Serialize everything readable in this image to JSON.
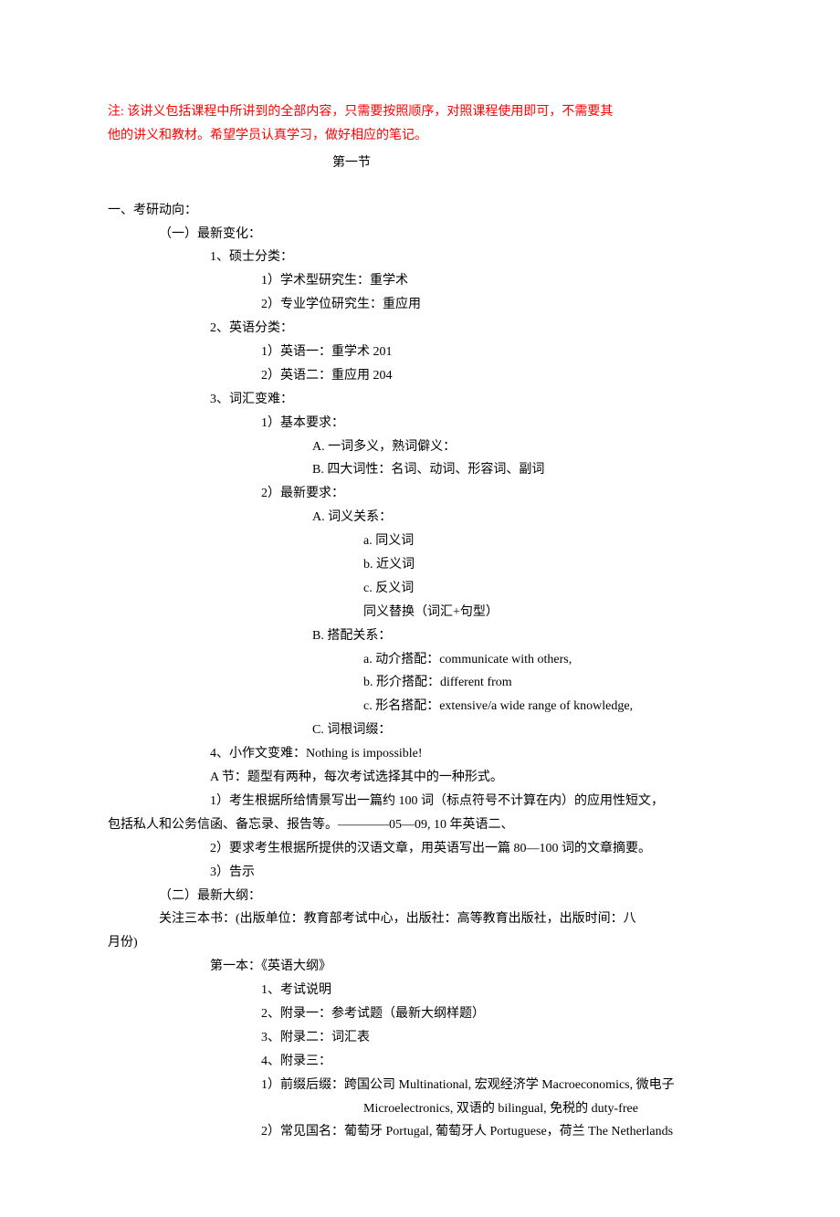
{
  "note": {
    "l1": "注: 该讲义包括课程中所讲到的全部内容，只需要按照顺序，对照课程使用即可，不需要其",
    "l2": "他的讲义和教材。希望学员认真学习，做好相应的笔记。"
  },
  "title": "第一节",
  "s1": {
    "t": "一、考研动向：",
    "a": "（一）最新变化：",
    "a1": "1、硕士分类：",
    "a1_1": "1）学术型研究生：重学术",
    "a1_2": "2）专业学位研究生：重应用",
    "a2": "2、英语分类：",
    "a2_1": "1）英语一：重学术 201",
    "a2_2": "2）英语二：重应用 204",
    "a3": "3、词汇变难：",
    "a3_1": "1）基本要求：",
    "a3_1a": "A.  一词多义，熟词僻义：",
    "a3_1b": "B.  四大词性：名词、动词、形容词、副词",
    "a3_2": "2）最新要求：",
    "a3_2a": "A.  词义关系：",
    "a3_2a_a": "a.    同义词",
    "a3_2a_b": "b.    近义词",
    "a3_2a_c": "c.    反义词",
    "a3_2a_d": "同义替换（词汇+句型）",
    "a3_2b": "B.  搭配关系：",
    "a3_2b_a": "a.  动介搭配：communicate with others,",
    "a3_2b_b": "b.  形介搭配：different from",
    "a3_2b_c": "c.  形名搭配：extensive/a wide range of knowledge,",
    "a3_2c": "C. 词根词缀：",
    "a4": "4、小作文变难：Nothing is impossible!",
    "a4_A": "A 节：题型有两种，每次考试选择其中的一种形式。",
    "a4_1_a": "1）考生根据所给情景写出一篇约 100 词（标点符号不计算在内）的应用性短文，",
    "a4_1_b": "包括私人和公务信函、备忘录、报告等。————05—09, 10 年英语二、",
    "a4_2": "2）要求考生根据所提供的汉语文章，用英语写出一篇 80—100 词的文章摘要。",
    "a4_3": "3）告示",
    "b": "（二）最新大纲：",
    "b0_a": "关注三本书：(出版单位：教育部考试中心，出版社：高等教育出版社，出版时间：八",
    "b0_b": "月份)",
    "b1": "第一本：《英语大纲》",
    "b1_1": "1、考试说明",
    "b1_2": "2、附录一：参考试题（最新大纲样题）",
    "b1_3": "3、附录二：词汇表",
    "b1_4": "4、附录三：",
    "b1_4_1a": "1）前缀后缀：跨国公司 Multinational, 宏观经济学 Macroeconomics, 微电子",
    "b1_4_1b": "Microelectronics, 双语的 bilingual, 免税的 duty-free",
    "b1_4_2": "2）常见国名：葡萄牙 Portugal, 葡萄牙人 Portuguese，荷兰 The Netherlands"
  }
}
